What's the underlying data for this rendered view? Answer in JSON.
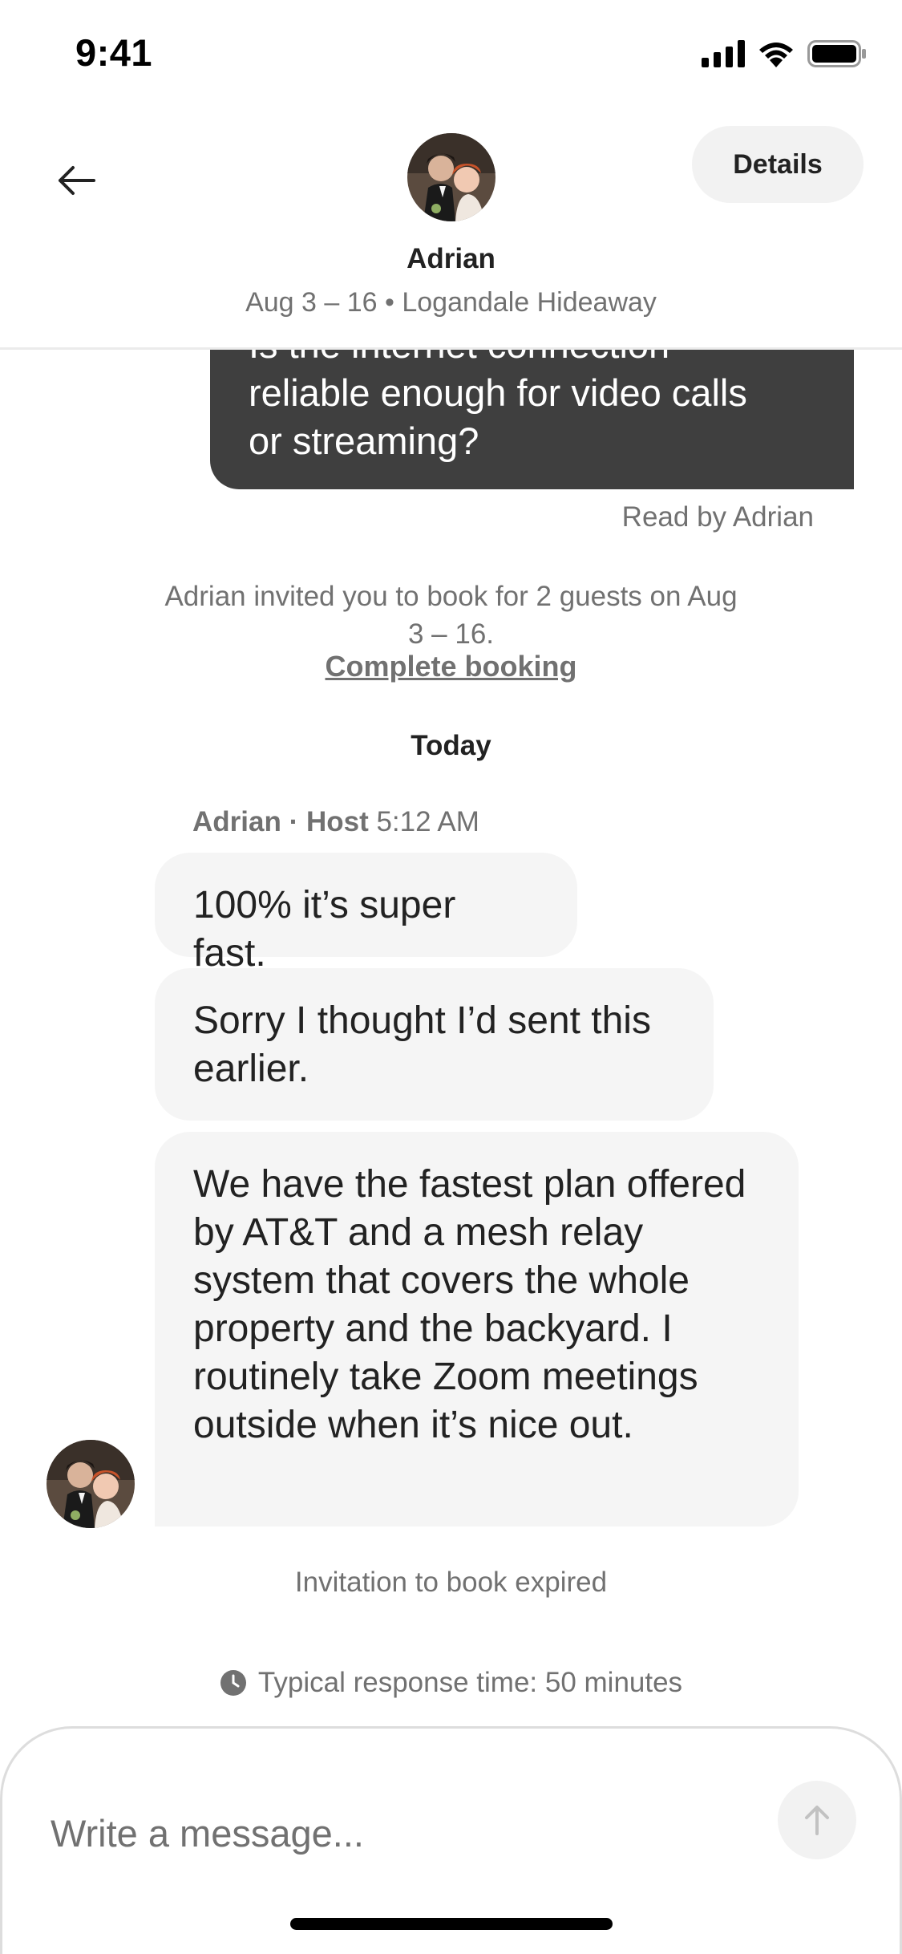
{
  "status_bar": {
    "time": "9:41",
    "icons": [
      "cellular-signal-icon",
      "wifi-icon",
      "battery-icon"
    ]
  },
  "header": {
    "back_icon": "arrow-left-icon",
    "avatar_icon": "host-avatar",
    "name": "Adrian",
    "subtitle": "Aug 3 – 16 • Logandale Hideaway",
    "details_label": "Details"
  },
  "thread": {
    "sent_message": {
      "clipped_line": "Is the internet connection",
      "lines": [
        "reliable enough for video calls",
        "or streaming?"
      ],
      "read_receipt": "Read by Adrian"
    },
    "system_invite": {
      "text": "Adrian invited you to book for 2 guests on Aug 3 – 16.",
      "link_label": "Complete booking"
    },
    "day_divider": "Today",
    "meta": {
      "author": "Adrian · Host",
      "time": "5:12 AM"
    },
    "received": [
      "100% it’s super fast.",
      "Sorry I thought I’d sent this earlier.",
      "We have the fastest plan offered by AT&T and a mesh relay system that covers the whole property and the backyard. I routinely take Zoom meetings outside when it’s nice out."
    ],
    "expired_notice": "Invitation to book expired",
    "response_time": "Typical response time: 50 minutes"
  },
  "composer": {
    "placeholder": "Write a message...",
    "value": "",
    "send_icon": "arrow-up-icon"
  },
  "colors": {
    "sent_bubble": "#3f3f3f",
    "received_bubble": "#f5f5f5",
    "muted_text": "#717171",
    "primary_text": "#222222",
    "button_bg": "#f2f2f2"
  }
}
